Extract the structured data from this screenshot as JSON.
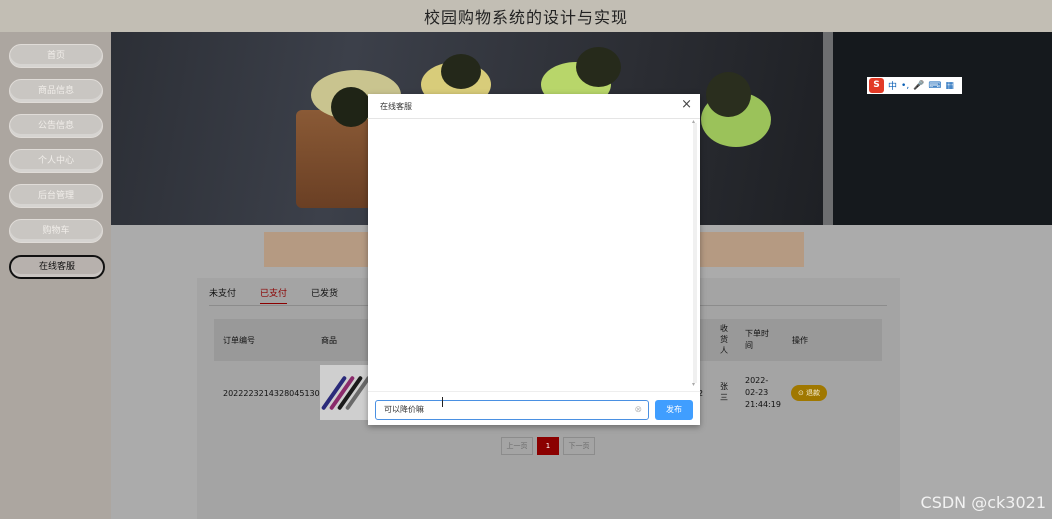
{
  "header": {
    "title": "校园购物系统的设计与实现"
  },
  "sidebar": {
    "items": [
      {
        "label": "首页"
      },
      {
        "label": "商品信息"
      },
      {
        "label": "公告信息"
      },
      {
        "label": "个人中心"
      },
      {
        "label": "后台管理"
      },
      {
        "label": "购物车"
      },
      {
        "label": "在线客服",
        "active": true
      }
    ]
  },
  "ime_toolbar": {
    "logo": "S",
    "lang": "中",
    "punct": "•,",
    "mic": "🎤",
    "keyboard": "⌨",
    "grid": "▦"
  },
  "orders": {
    "tabs": [
      {
        "label": "未支付"
      },
      {
        "label": "已支付",
        "active": true
      },
      {
        "label": "已发货"
      }
    ],
    "columns": {
      "order_no": "订单编号",
      "product": "商品",
      "receiver": "收货人",
      "order_time": "下单时间",
      "action": "操作"
    },
    "rows": [
      {
        "order_no": "2022223214328045130",
        "col_frag": "2",
        "receiver": "张三",
        "order_time": "2022-02-23 21:44:19",
        "action_label": "退款"
      }
    ],
    "pagination": {
      "prev": "上一页",
      "current": "1",
      "next": "下一页"
    }
  },
  "chat_dialog": {
    "title": "在线客服",
    "close": "×",
    "input_value": "可以降价嘛",
    "send_label": "发布"
  },
  "watermark": "CSDN @ck3021",
  "colors": {
    "accent": "#409eff",
    "active_tab": "#8b0000",
    "action_btn": "#a07800"
  }
}
